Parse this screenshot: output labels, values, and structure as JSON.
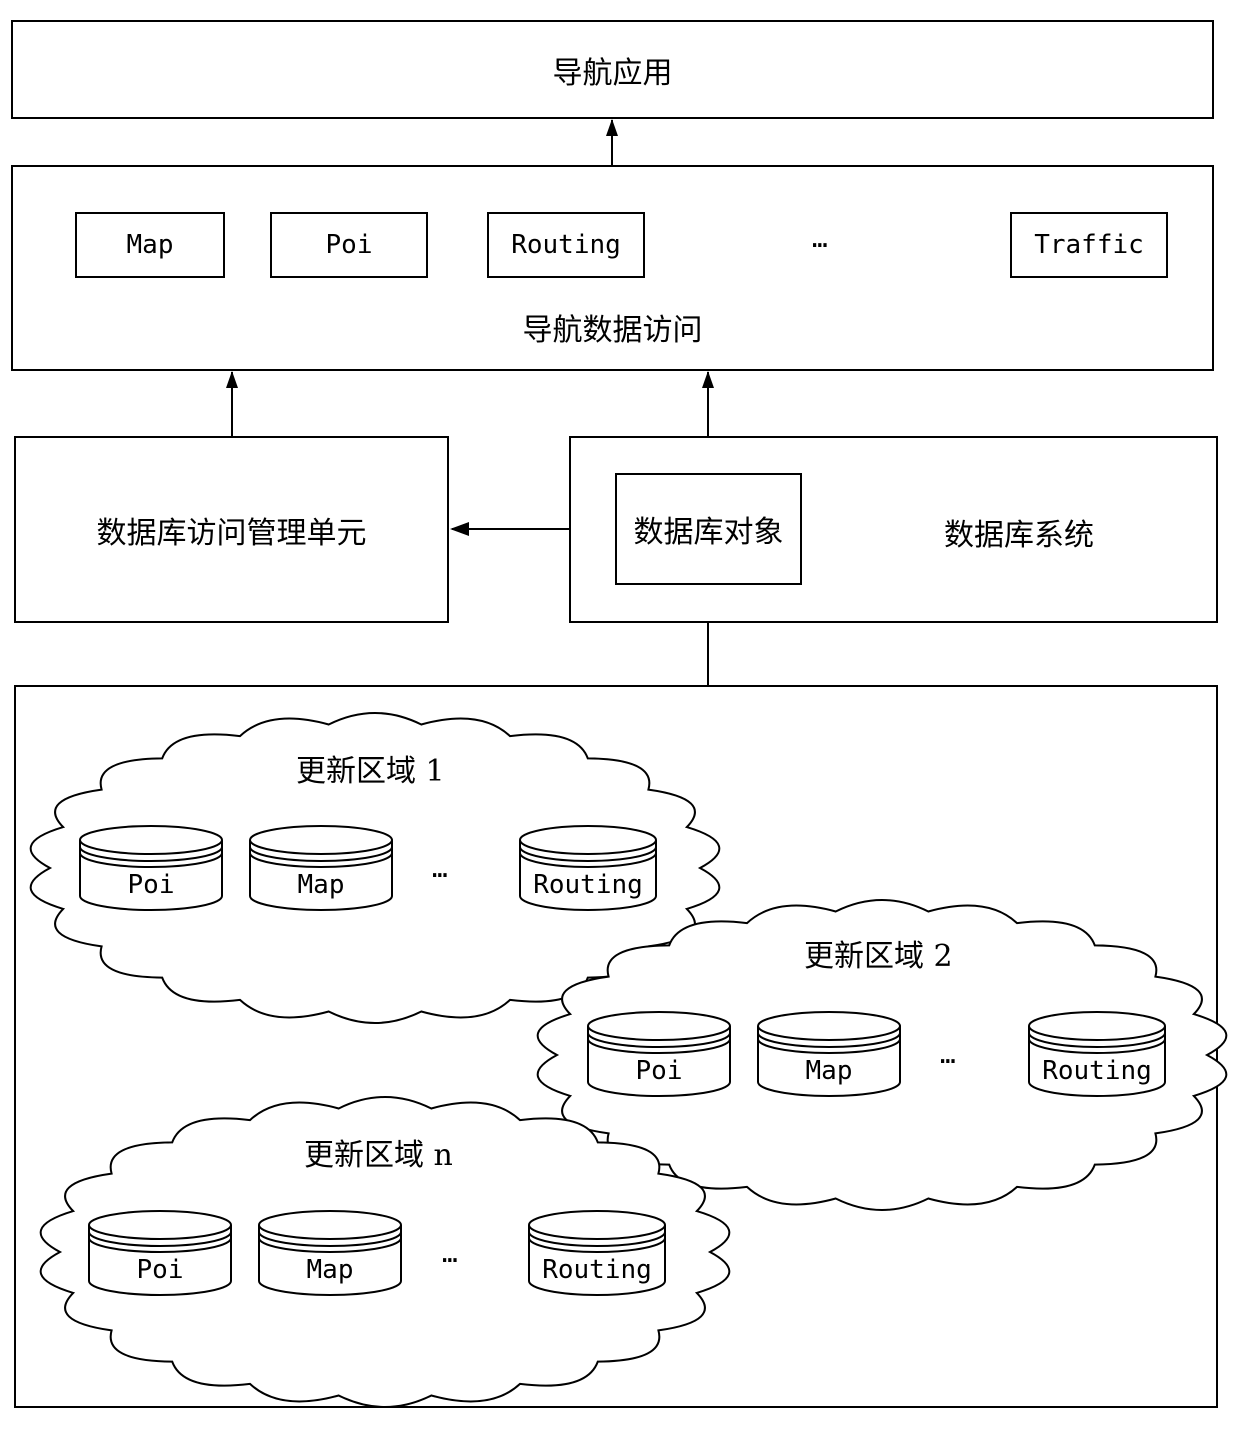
{
  "diagram": {
    "nav_app": {
      "label": "导航应用"
    },
    "nav_data_access": {
      "label": "导航数据访问",
      "modules": [
        "Map",
        "Poi",
        "Routing",
        "…",
        "Traffic"
      ]
    },
    "db_access_manager": {
      "label": "数据库访问管理单元"
    },
    "db_system": {
      "label": "数据库系统",
      "db_object_label": "数据库对象"
    },
    "update_regions": [
      {
        "title": "更新区域 1",
        "stores": [
          "Poi",
          "Map",
          "…",
          "Routing"
        ]
      },
      {
        "title": "更新区域 2",
        "stores": [
          "Poi",
          "Map",
          "…",
          "Routing"
        ]
      },
      {
        "title": "更新区域 n",
        "stores": [
          "Poi",
          "Map",
          "…",
          "Routing"
        ]
      }
    ],
    "edges": [
      {
        "from": "nav_data_access",
        "to": "nav_app",
        "type": "arrow"
      },
      {
        "from": "db_access_manager",
        "to": "nav_data_access",
        "type": "arrow"
      },
      {
        "from": "db_system",
        "to": "nav_data_access",
        "type": "arrow"
      },
      {
        "from": "db_system",
        "to": "db_access_manager",
        "type": "arrow"
      },
      {
        "from": "db_system",
        "to": "update_regions_container",
        "type": "line"
      }
    ]
  }
}
